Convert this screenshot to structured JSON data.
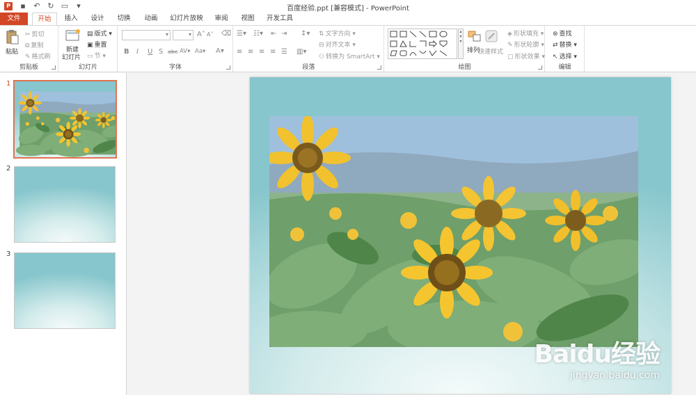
{
  "window": {
    "title": "百度经验.ppt [兼容模式] - PowerPoint",
    "app_icon": "P"
  },
  "quick_access": [
    "save-icon",
    "undo-icon",
    "redo-icon",
    "slideshow-icon",
    "customize-icon"
  ],
  "tabs": [
    {
      "label": "文件",
      "file": true
    },
    {
      "label": "开始",
      "active": true
    },
    {
      "label": "插入"
    },
    {
      "label": "设计"
    },
    {
      "label": "切换"
    },
    {
      "label": "动画"
    },
    {
      "label": "幻灯片放映"
    },
    {
      "label": "审阅"
    },
    {
      "label": "视图"
    },
    {
      "label": "开发工具"
    }
  ],
  "ribbon": {
    "clipboard": {
      "label": "剪贴板",
      "paste": "粘贴",
      "cut": "剪切",
      "copy": "复制",
      "format_painter": "格式刷"
    },
    "slides": {
      "label": "幻灯片",
      "new_slide_line1": "新建",
      "new_slide_line2": "幻灯片",
      "layout": "版式",
      "reset": "重置",
      "section": "节"
    },
    "font": {
      "label": "字体",
      "font_name": "",
      "font_size": "",
      "bold": "B",
      "italic": "I",
      "underline": "U",
      "shadow": "S",
      "strike": "abc",
      "spacing": "AV",
      "case": "Aa",
      "color": "A",
      "grow": "A",
      "shrink": "A"
    },
    "paragraph": {
      "label": "段落",
      "text_direction": "文字方向",
      "align_text": "对齐文本",
      "smartart": "转换为 SmartArt"
    },
    "drawing": {
      "label": "绘图",
      "arrange": "排列",
      "quick_styles": "快速样式",
      "shape_fill": "形状填充",
      "shape_outline": "形状轮廓",
      "shape_effects": "形状效果"
    },
    "editing": {
      "label": "编辑",
      "find": "查找",
      "replace": "替换",
      "select": "选择"
    }
  },
  "slides_panel": {
    "numbers": [
      "1",
      "2",
      "3"
    ],
    "selected": 1
  },
  "watermark": {
    "logo": "Baidu经验",
    "url": "jingyan.baidu.com"
  },
  "colors": {
    "accent": "#d24726",
    "teal": "#86c6cc",
    "sunflower": "#f2c12e"
  }
}
